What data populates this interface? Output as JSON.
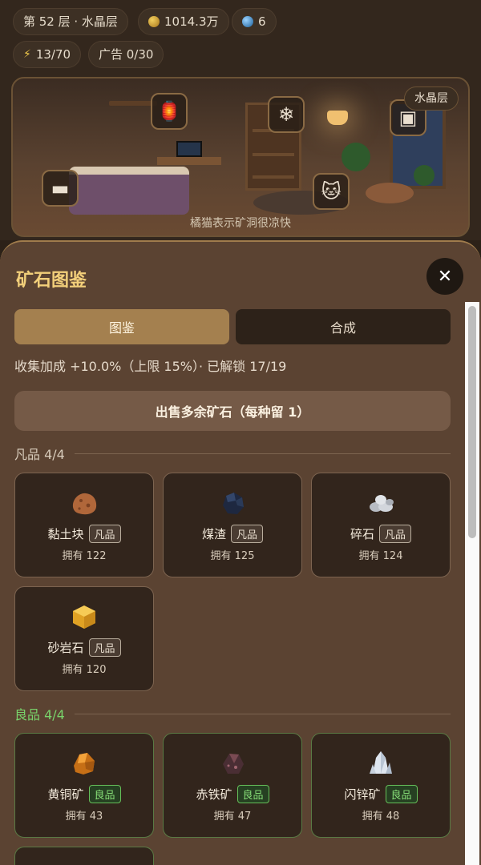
{
  "status": {
    "floor": "第 52 层 · 水晶层",
    "coins": "1014.3万",
    "gems": "6",
    "energy": "13/70",
    "ads": "广告 0/30"
  },
  "scene": {
    "badge": "水晶层",
    "caption": "橘猫表示矿洞很凉快"
  },
  "sheet": {
    "title": "矿石图鉴",
    "close_label": "✕",
    "tabs": [
      {
        "label": "图鉴",
        "active": true
      },
      {
        "label": "合成",
        "active": false
      }
    ],
    "bonus_text": "收集加成 +10.0%（上限 15%）· 已解锁 17/19",
    "sell_button": "出售多余矿石（每种留 1）",
    "sections": [
      {
        "title": "凡品 4/4",
        "title_color": "#d8ccbb",
        "items": [
          {
            "name": "黏土块",
            "rarity": "凡品",
            "owned": "拥有 122",
            "color": "#b0673a"
          },
          {
            "name": "煤渣",
            "rarity": "凡品",
            "owned": "拥有 125",
            "color": "#26324a"
          },
          {
            "name": "碎石",
            "rarity": "凡品",
            "owned": "拥有 124",
            "color": "#c5c9cf"
          },
          {
            "name": "砂岩石",
            "rarity": "凡品",
            "owned": "拥有 120",
            "color": "#f0bb35"
          }
        ]
      },
      {
        "title": "良品 4/4",
        "title_color": "#79d36b",
        "items": [
          {
            "name": "黄铜矿",
            "rarity": "良品",
            "owned": "拥有 43",
            "color": "#e08a24"
          },
          {
            "name": "赤铁矿",
            "rarity": "良品",
            "owned": "拥有 47",
            "color": "#5a3a40"
          },
          {
            "name": "闪锌矿",
            "rarity": "良品",
            "owned": "拥有 48",
            "color": "#e8eef5"
          }
        ]
      }
    ]
  }
}
